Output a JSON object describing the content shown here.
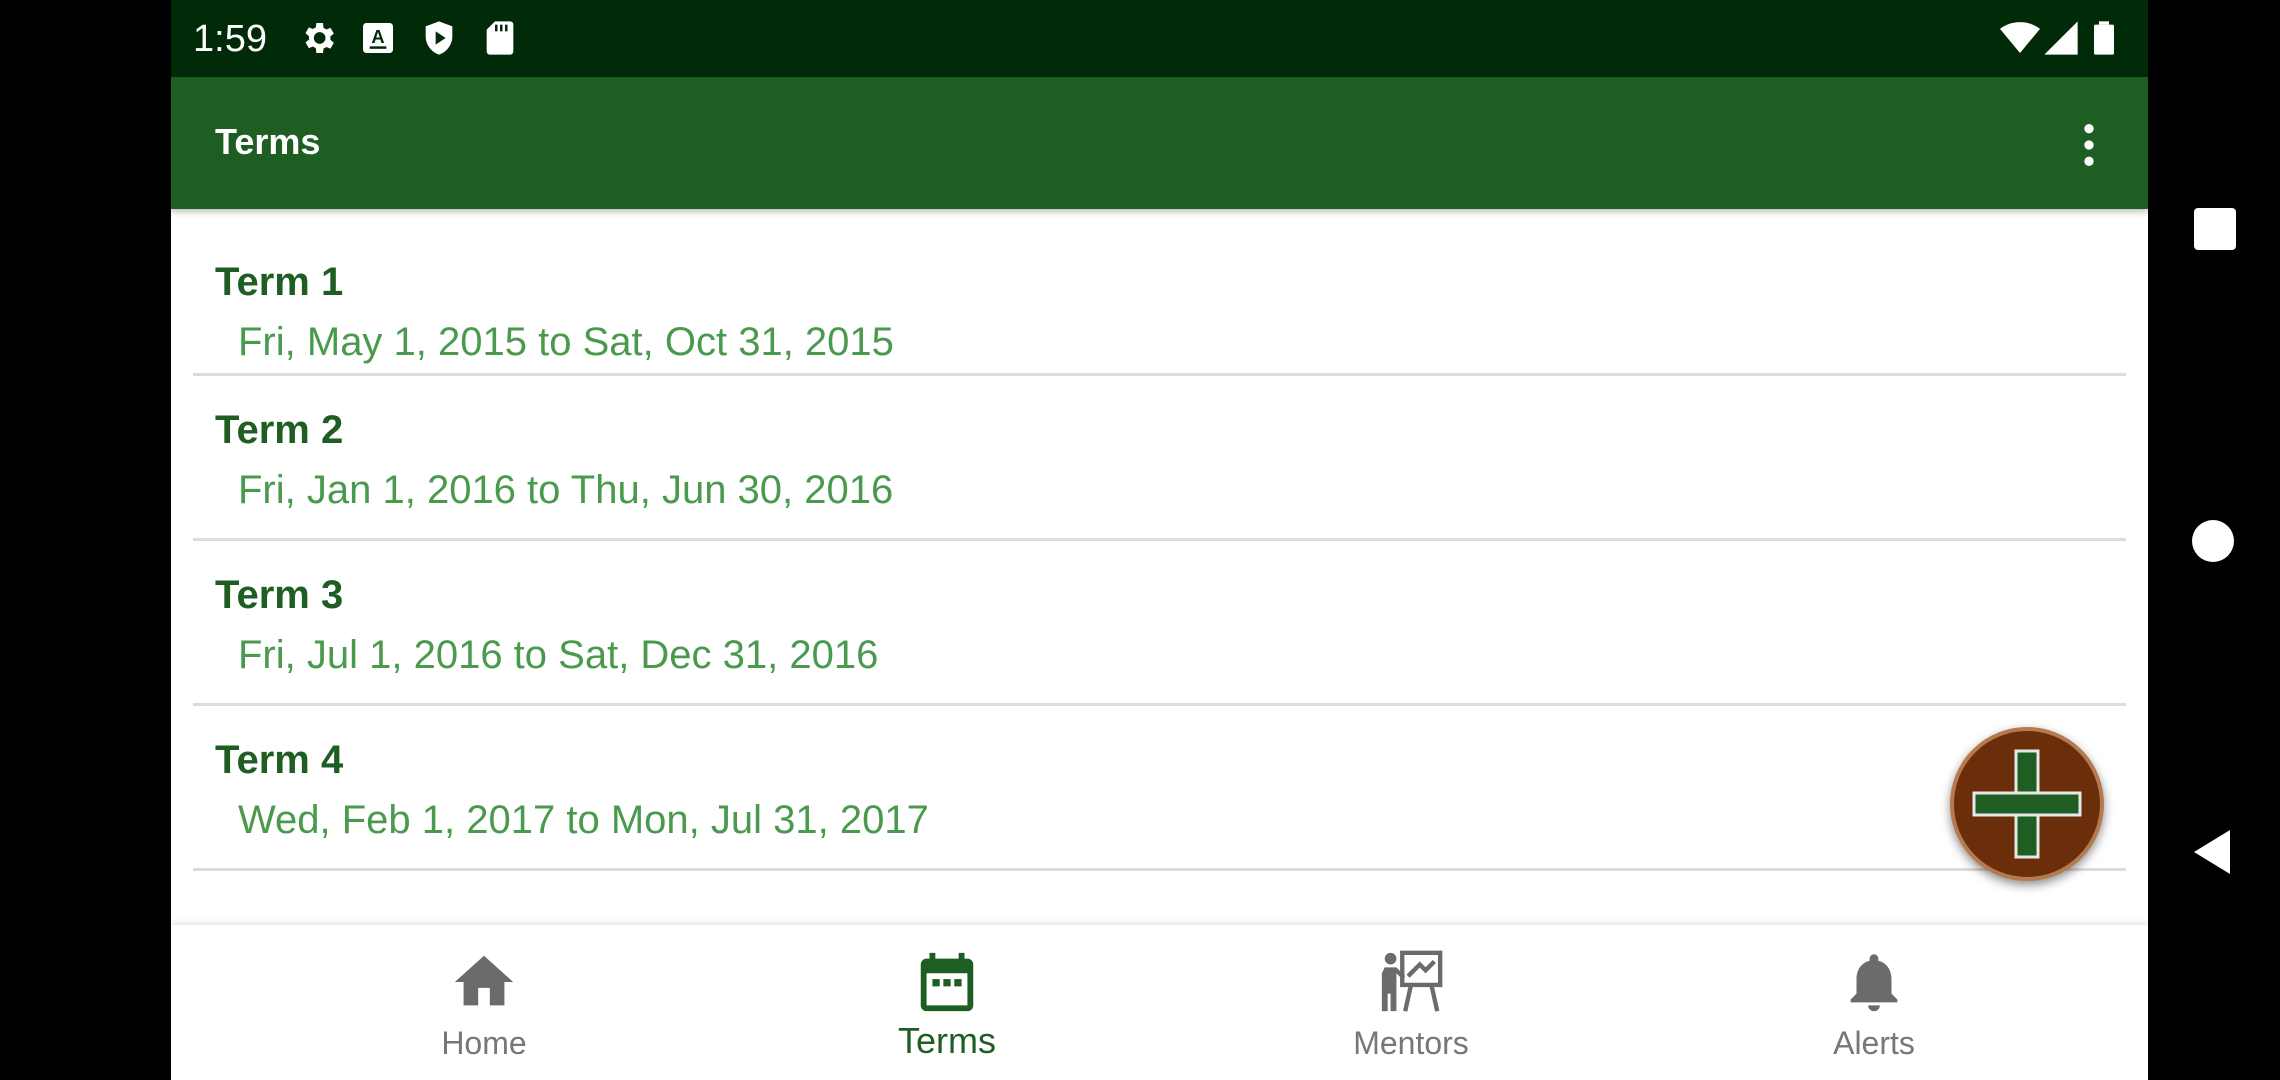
{
  "status_bar": {
    "time": "1:59",
    "left_icons": [
      "gear-icon",
      "keyboard-a-icon",
      "play-protect-icon",
      "sd-card-icon"
    ],
    "right_icons": [
      "wifi-icon",
      "signal-icon",
      "battery-icon"
    ]
  },
  "app_bar": {
    "title": "Terms",
    "overflow_icon": "more-vert-icon"
  },
  "terms": [
    {
      "title": "Term 1",
      "dates": "Fri, May 1, 2015 to Sat, Oct 31, 2015"
    },
    {
      "title": "Term 2",
      "dates": "Fri, Jan 1, 2016 to Thu, Jun 30, 2016"
    },
    {
      "title": "Term 3",
      "dates": "Fri, Jul 1, 2016 to Sat, Dec 31, 2016"
    },
    {
      "title": "Term 4",
      "dates": "Wed, Feb 1, 2017 to Mon, Jul 31, 2017"
    }
  ],
  "fab": {
    "icon": "add-icon"
  },
  "bottom_nav": {
    "items": [
      {
        "label": "Home",
        "icon": "home-icon",
        "active": false
      },
      {
        "label": "Terms",
        "icon": "calendar-icon",
        "active": true
      },
      {
        "label": "Mentors",
        "icon": "teacher-icon",
        "active": false
      },
      {
        "label": "Alerts",
        "icon": "bell-icon",
        "active": false
      }
    ]
  },
  "system_nav": {
    "icons": [
      "recents-icon",
      "home-circle-icon",
      "back-icon"
    ]
  },
  "colors": {
    "primary": "#1e5e22",
    "status_bar": "#002a08",
    "secondary_text": "#4a9a4e",
    "fab": "#6b2e0a"
  }
}
